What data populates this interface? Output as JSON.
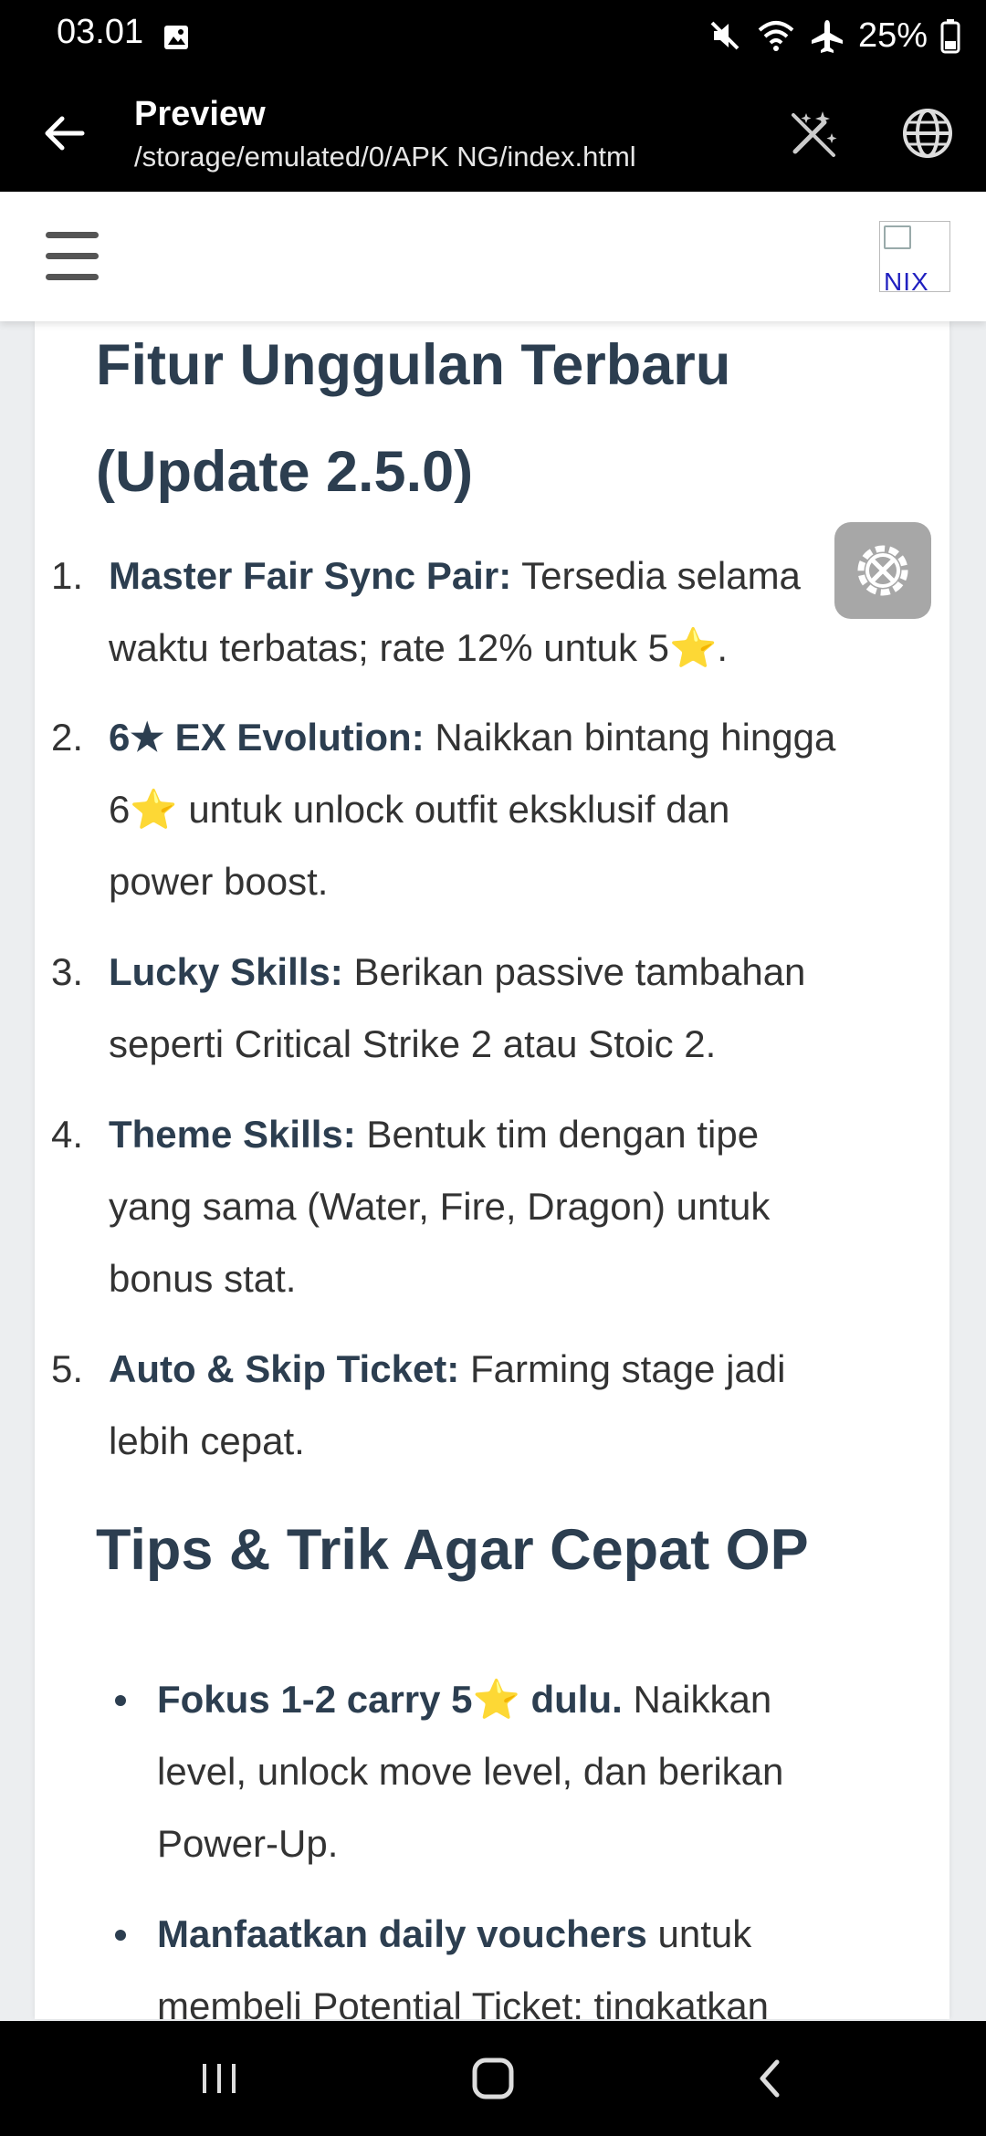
{
  "status": {
    "time": "03.01",
    "battery": "25%",
    "icons": [
      "image-icon",
      "mute-icon",
      "wifi-icon",
      "airplane-icon",
      "battery-icon"
    ]
  },
  "toolbar": {
    "title": "Preview",
    "path": "/storage/emulated/0/APK NG/index.html",
    "icons": [
      "back-arrow-icon",
      "magic-wand-off-icon",
      "globe-icon"
    ]
  },
  "site": {
    "logo_text": "NIX",
    "icons": [
      "hamburger-menu-icon"
    ]
  },
  "article": {
    "heading1_line1": "Fitur Unggulan Terbaru",
    "heading1_line2": "(Update 2.5.0)",
    "features": [
      {
        "num": "1.",
        "bold": "Master Fair Sync Pair:",
        "line1": " Tersedia selama",
        "line2a": "waktu terbatas; rate 12% untuk 5",
        "line2b": "."
      },
      {
        "num": "2.",
        "bold_pre": "6",
        "bold_post": " EX Evolution:",
        "line1": " Naikkan bintang hingga",
        "line2a": "6",
        "line2b": " untuk unlock outfit eksklusif dan",
        "line3": "power boost."
      },
      {
        "num": "3.",
        "bold": "Lucky Skills:",
        "line1": " Berikan passive tambahan",
        "line2": "seperti Critical Strike 2 atau Stoic 2."
      },
      {
        "num": "4.",
        "bold": "Theme Skills:",
        "line1": " Bentuk tim dengan tipe",
        "line2": "yang sama (Water, Fire, Dragon) untuk",
        "line3": "bonus stat."
      },
      {
        "num": "5.",
        "bold": "Auto & Skip Ticket:",
        "line1": " Farming stage jadi",
        "line2": "lebih cepat."
      }
    ],
    "heading2": "Tips & Trik Agar Cepat OP",
    "tips": [
      {
        "bold_a": "Fokus 1-2 carry 5",
        "bold_b": " dulu.",
        "line1": " Naikkan",
        "line2": "level, unlock move level, dan berikan",
        "line3": "Power-Up."
      },
      {
        "bold": "Manfaatkan daily vouchers",
        "line1": " untuk",
        "line2": "membeli Potential Ticket; tingkatkan"
      }
    ],
    "star_char": "★",
    "star_emoji": "⭐"
  },
  "colors": {
    "heading": "#2c3e50",
    "star": "#f5b800",
    "toolbar_bg": "#000000"
  },
  "floating": {
    "icon": "settings-tools-icon"
  },
  "navbar": {
    "icons": [
      "recents-icon",
      "home-icon",
      "back-icon"
    ]
  }
}
